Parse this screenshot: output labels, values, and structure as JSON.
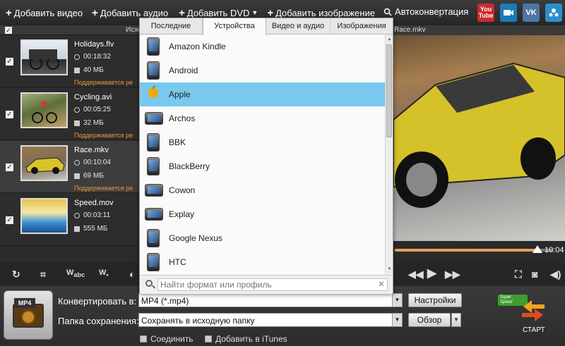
{
  "toolbar": {
    "add_video": "Добавить видео",
    "add_audio": "Добавить аудио",
    "add_dvd": "Добавить DVD",
    "add_image": "Добавить изображение",
    "autoconvert": "Автоконвертация",
    "youtube_top": "You",
    "youtube_bottom": "Tube",
    "vk": "VK"
  },
  "list_header": {
    "label": "Исхо"
  },
  "files": [
    {
      "name": "Holidays.flv",
      "duration": "00:18:32",
      "size": "40 МБ",
      "support": "Поддерживается ре"
    },
    {
      "name": "Cycling.avi",
      "duration": "00:05:25",
      "size": "32 МБ",
      "support": "Поддерживается ре"
    },
    {
      "name": "Race.mkv",
      "duration": "00:10:04",
      "size": "69 МБ",
      "support": "Поддерживается ре"
    },
    {
      "name": "Speed.mov",
      "duration": "00:03:11",
      "size": "555 МБ"
    }
  ],
  "preview": {
    "title": "Race.mkv",
    "time": "10:04",
    "progress": 0.9
  },
  "popup": {
    "tabs": [
      "Последние",
      "Устройства",
      "Видео и аудио",
      "Изображения"
    ],
    "active_tab": "Устройства",
    "devices": [
      "Amazon Kindle",
      "Android",
      "Apple",
      "Archos",
      "BBK",
      "BlackBerry",
      "Cowon",
      "Explay",
      "Google Nexus",
      "HTC"
    ],
    "selected_device": "Apple",
    "search_placeholder": "Найти формат или профиль"
  },
  "bottom": {
    "format_tag": "MP4",
    "convert_label": "Конвертировать в:",
    "convert_value": "MP4 (*.mp4)",
    "speed_line1": "Super",
    "speed_line2": "Speed",
    "settings_button": "Настройки",
    "folder_label": "Папка сохранения:",
    "folder_value": "Сохранять в исходную папку",
    "browse_button": "Обзор",
    "join_label": "Соединить",
    "itunes_label": "Добавить в iTunes",
    "start_label": "СТАРТ"
  },
  "colors": {
    "accent": "#e79a3c",
    "selection": "#79c8ee",
    "speed_badge": "#3d9d2f"
  }
}
